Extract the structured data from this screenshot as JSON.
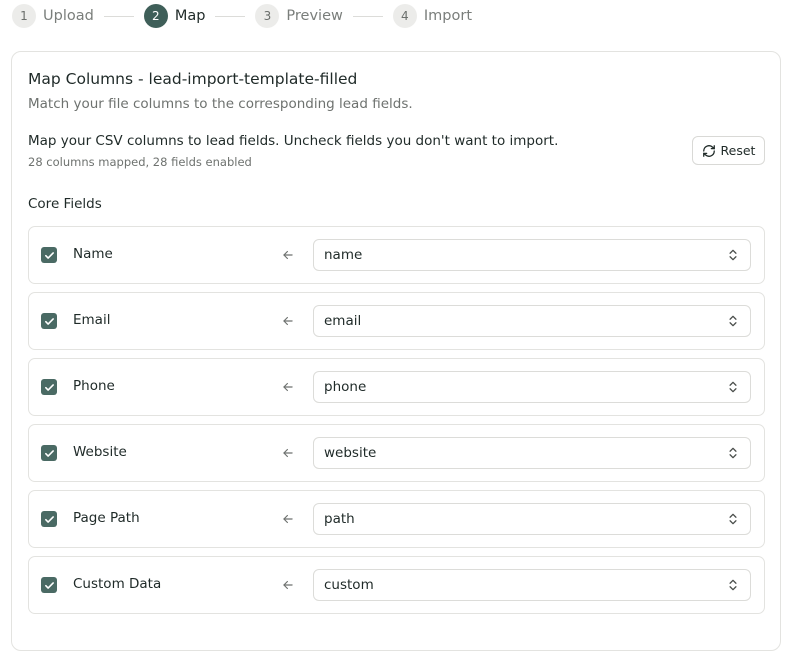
{
  "stepper": {
    "steps": [
      {
        "number": "1",
        "label": "Upload",
        "active": false
      },
      {
        "number": "2",
        "label": "Map",
        "active": true
      },
      {
        "number": "3",
        "label": "Preview",
        "active": false
      },
      {
        "number": "4",
        "label": "Import",
        "active": false
      }
    ]
  },
  "card": {
    "title": "Map Columns - lead-import-template-filled",
    "subtitle": "Match your file columns to the corresponding lead fields.",
    "instructions": "Map your CSV columns to lead fields. Uncheck fields you don't want to import.",
    "summary": "28 columns mapped, 28 fields enabled",
    "reset_label": "Reset",
    "section_title": "Core Fields"
  },
  "fields": [
    {
      "name": "Name",
      "checked": true,
      "column": "name"
    },
    {
      "name": "Email",
      "checked": true,
      "column": "email"
    },
    {
      "name": "Phone",
      "checked": true,
      "column": "phone"
    },
    {
      "name": "Website",
      "checked": true,
      "column": "website"
    },
    {
      "name": "Page Path",
      "checked": true,
      "column": "path"
    },
    {
      "name": "Custom Data",
      "checked": true,
      "column": "custom"
    }
  ],
  "colors": {
    "accent": "#3f5f59",
    "checkbox": "#4a6a64"
  },
  "icons": {
    "reset": "refresh-icon",
    "arrow": "arrow-left-icon",
    "chevron": "chevron-up-down-icon",
    "check": "check-icon"
  }
}
